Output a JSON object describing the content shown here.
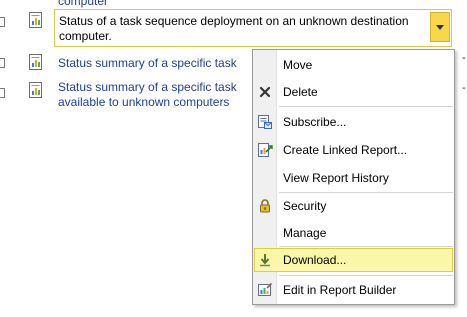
{
  "report_list": {
    "top_partial_text": "computer",
    "rows": [
      {
        "title": "Status of a task sequence deployment on an unknown destination computer."
      },
      {
        "title": "Status summary of a specific task"
      },
      {
        "title": "Status summary of a specific task available to unknown computers"
      }
    ]
  },
  "context_menu": {
    "items": [
      {
        "label": "Move",
        "icon": "none"
      },
      {
        "label": "Delete",
        "icon": "delete-x-icon"
      },
      {
        "label": "Subscribe...",
        "icon": "subscribe-icon"
      },
      {
        "label": "Create Linked Report...",
        "icon": "linked-report-icon"
      },
      {
        "label": "View Report History",
        "icon": "none"
      },
      {
        "label": "Security",
        "icon": "lock-icon"
      },
      {
        "label": "Manage",
        "icon": "none"
      },
      {
        "label": "Download...",
        "icon": "download-icon",
        "highlighted": true
      },
      {
        "label": "Edit in Report Builder",
        "icon": "report-builder-icon"
      }
    ]
  },
  "colors": {
    "link": "#1f3f99",
    "selected_border": "#e6c542",
    "dropdown_button": "#f7d84b",
    "menu_highlight": "#faf7a8"
  }
}
